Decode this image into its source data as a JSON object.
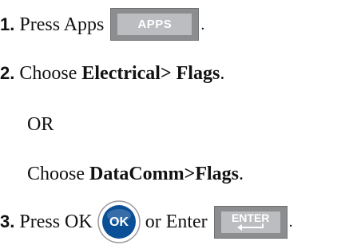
{
  "steps": {
    "s1": {
      "num": "1.",
      "text": "Press Apps",
      "key": "APPS",
      "end": "."
    },
    "s2": {
      "num": "2.",
      "pre": "Choose ",
      "bold": "Electrical> Flags",
      "end": "."
    },
    "or": "OR",
    "s2b": {
      "pre": "Choose ",
      "bold": "DataComm>Flags",
      "end": "."
    },
    "s3": {
      "num": "3.",
      "text": "Press OK",
      "ok": "OK",
      "mid": "or Enter",
      "key": "ENTER",
      "end": "."
    }
  },
  "colors": {
    "key_outer": "#8c8d8f",
    "key_inner": "#bcbdc0",
    "ok_blue": "#0b4f96"
  },
  "icons": {
    "ok": "ok-round-button-icon",
    "enter": "enter-arrow-icon"
  }
}
